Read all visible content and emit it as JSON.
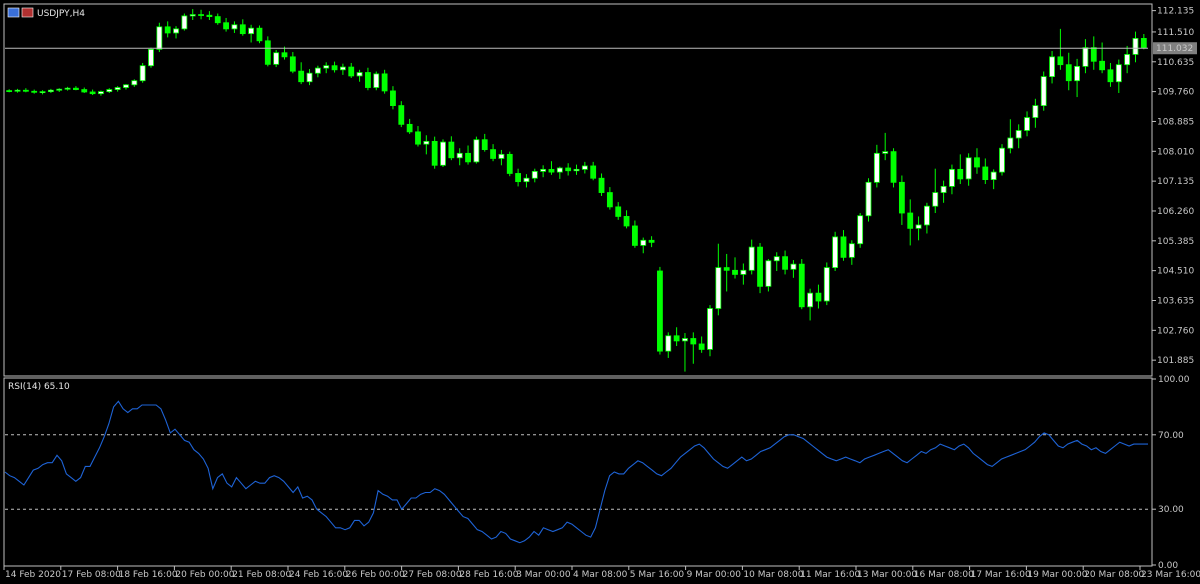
{
  "window": {
    "symbol_title": "USDJPY,H4",
    "indicator_title": "RSI(14) 65.10"
  },
  "colors": {
    "background": "#000000",
    "frame": "#c0c0c0",
    "text": "#c8c8c8",
    "bull": "#00ff00",
    "bull_body": "#ffffff",
    "bear_body": "#00ff00",
    "rsi_line": "#1e63d6",
    "level_line": "#bfbfbf",
    "price_line": "#bcbcbc",
    "current_price_bg": "#808080"
  },
  "chart_data": [
    {
      "type": "candlestick",
      "title": "USDJPY,H4",
      "ylim": [
        101.45,
        112.3
      ],
      "y_ticks": [
        "112.135",
        "111.510",
        "110.635",
        "109.760",
        "108.885",
        "108.010",
        "107.135",
        "106.260",
        "105.385",
        "104.510",
        "103.635",
        "102.760",
        "101.885"
      ],
      "x_ticks": [
        "14 Feb 2020",
        "17 Feb 08:00",
        "18 Feb 16:00",
        "20 Feb 00:00",
        "21 Feb 08:00",
        "24 Feb 16:00",
        "26 Feb 00:00",
        "27 Feb 08:00",
        "28 Feb 16:00",
        "3 Mar 00:00",
        "4 Mar 08:00",
        "5 Mar 16:00",
        "9 Mar 00:00",
        "10 Mar 08:00",
        "11 Mar 16:00",
        "13 Mar 00:00",
        "16 Mar 08:00",
        "17 Mar 16:00",
        "19 Mar 00:00",
        "20 Mar 08:00",
        "23 Mar 16:00"
      ],
      "current_price": "111.032",
      "ohlc": [
        [
          109.79,
          109.83,
          109.74,
          109.78
        ],
        [
          109.78,
          109.84,
          109.73,
          109.8
        ],
        [
          109.8,
          109.86,
          109.74,
          109.77
        ],
        [
          109.77,
          109.82,
          109.7,
          109.74
        ],
        [
          109.74,
          109.8,
          109.68,
          109.76
        ],
        [
          109.76,
          109.84,
          109.72,
          109.8
        ],
        [
          109.8,
          109.86,
          109.75,
          109.83
        ],
        [
          109.83,
          109.9,
          109.79,
          109.86
        ],
        [
          109.86,
          109.92,
          109.8,
          109.82
        ],
        [
          109.82,
          109.88,
          109.72,
          109.75
        ],
        [
          109.75,
          109.82,
          109.66,
          109.7
        ],
        [
          109.7,
          109.79,
          109.64,
          109.76
        ],
        [
          109.76,
          109.86,
          109.72,
          109.82
        ],
        [
          109.82,
          109.92,
          109.76,
          109.88
        ],
        [
          109.88,
          109.98,
          109.82,
          109.96
        ],
        [
          109.96,
          110.12,
          109.9,
          110.08
        ],
        [
          110.08,
          110.6,
          110.02,
          110.52
        ],
        [
          110.52,
          111.05,
          110.46,
          111.0
        ],
        [
          111.0,
          111.78,
          110.92,
          111.66
        ],
        [
          111.66,
          111.82,
          111.35,
          111.48
        ],
        [
          111.48,
          111.68,
          111.32,
          111.6
        ],
        [
          111.6,
          112.05,
          111.55,
          111.98
        ],
        [
          111.98,
          112.18,
          111.86,
          112.02
        ],
        [
          112.02,
          112.16,
          111.88,
          112.0
        ],
        [
          112.0,
          112.12,
          111.86,
          111.96
        ],
        [
          111.96,
          112.05,
          111.72,
          111.78
        ],
        [
          111.78,
          111.92,
          111.52,
          111.6
        ],
        [
          111.6,
          111.82,
          111.48,
          111.72
        ],
        [
          111.72,
          111.88,
          111.4,
          111.46
        ],
        [
          111.46,
          111.72,
          111.2,
          111.62
        ],
        [
          111.62,
          111.7,
          111.18,
          111.25
        ],
        [
          111.25,
          111.38,
          110.5,
          110.56
        ],
        [
          110.56,
          110.98,
          110.48,
          110.9
        ],
        [
          110.9,
          111.08,
          110.7,
          110.78
        ],
        [
          110.78,
          110.92,
          110.3,
          110.36
        ],
        [
          110.36,
          110.62,
          109.98,
          110.05
        ],
        [
          110.05,
          110.42,
          109.95,
          110.3
        ],
        [
          110.3,
          110.52,
          110.18,
          110.45
        ],
        [
          110.45,
          110.62,
          110.3,
          110.52
        ],
        [
          110.52,
          110.64,
          110.32,
          110.4
        ],
        [
          110.4,
          110.58,
          110.25,
          110.48
        ],
        [
          110.48,
          110.6,
          110.16,
          110.22
        ],
        [
          110.22,
          110.4,
          110.05,
          110.32
        ],
        [
          110.32,
          110.46,
          109.8,
          109.88
        ],
        [
          109.88,
          110.35,
          109.8,
          110.28
        ],
        [
          110.28,
          110.4,
          109.7,
          109.78
        ],
        [
          109.78,
          109.92,
          109.24,
          109.35
        ],
        [
          109.35,
          109.48,
          108.72,
          108.8
        ],
        [
          108.8,
          108.96,
          108.52,
          108.58
        ],
        [
          108.58,
          108.75,
          108.15,
          108.22
        ],
        [
          108.22,
          108.48,
          107.92,
          108.3
        ],
        [
          108.3,
          108.44,
          107.5,
          107.6
        ],
        [
          107.6,
          108.36,
          107.55,
          108.28
        ],
        [
          108.28,
          108.45,
          107.75,
          107.82
        ],
        [
          107.82,
          108.1,
          107.6,
          107.95
        ],
        [
          107.95,
          108.18,
          107.62,
          107.7
        ],
        [
          107.7,
          108.44,
          107.65,
          108.35
        ],
        [
          108.35,
          108.52,
          108.0,
          108.06
        ],
        [
          108.06,
          108.22,
          107.72,
          107.8
        ],
        [
          107.8,
          108.05,
          107.6,
          107.92
        ],
        [
          107.92,
          108.0,
          107.28,
          107.36
        ],
        [
          107.36,
          107.5,
          106.98,
          107.12
        ],
        [
          107.12,
          107.34,
          106.95,
          107.22
        ],
        [
          107.22,
          107.5,
          107.1,
          107.42
        ],
        [
          107.42,
          107.6,
          107.25,
          107.48
        ],
        [
          107.48,
          107.72,
          107.32,
          107.4
        ],
        [
          107.4,
          107.56,
          107.2,
          107.52
        ],
        [
          107.52,
          107.66,
          107.3,
          107.44
        ],
        [
          107.44,
          107.62,
          107.32,
          107.48
        ],
        [
          107.48,
          107.7,
          107.36,
          107.58
        ],
        [
          107.58,
          107.7,
          107.16,
          107.22
        ],
        [
          107.22,
          107.36,
          106.7,
          106.8
        ],
        [
          106.8,
          106.96,
          106.3,
          106.38
        ],
        [
          106.38,
          106.52,
          106.0,
          106.1
        ],
        [
          106.1,
          106.28,
          105.75,
          105.82
        ],
        [
          105.82,
          105.98,
          105.18,
          105.25
        ],
        [
          105.25,
          105.48,
          105.02,
          105.4
        ],
        [
          105.4,
          105.52,
          105.2,
          105.34
        ],
        [
          104.5,
          104.62,
          102.05,
          102.15
        ],
        [
          102.15,
          102.7,
          101.95,
          102.6
        ],
        [
          102.6,
          102.85,
          102.3,
          102.45
        ],
        [
          102.45,
          102.68,
          101.55,
          102.52
        ],
        [
          102.52,
          102.7,
          101.78,
          102.36
        ],
        [
          102.36,
          102.58,
          102.1,
          102.2
        ],
        [
          102.2,
          103.5,
          102.0,
          103.4
        ],
        [
          103.4,
          105.3,
          103.2,
          104.6
        ],
        [
          104.6,
          105.0,
          103.9,
          104.52
        ],
        [
          104.52,
          104.9,
          104.28,
          104.4
        ],
        [
          104.4,
          104.72,
          104.1,
          104.52
        ],
        [
          104.52,
          105.42,
          104.4,
          105.2
        ],
        [
          105.2,
          105.32,
          103.85,
          104.05
        ],
        [
          104.05,
          104.85,
          103.9,
          104.8
        ],
        [
          104.8,
          105.05,
          104.5,
          104.92
        ],
        [
          104.92,
          105.1,
          104.4,
          104.55
        ],
        [
          104.55,
          104.82,
          104.3,
          104.7
        ],
        [
          104.7,
          104.85,
          103.38,
          103.45
        ],
        [
          103.45,
          103.98,
          103.05,
          103.85
        ],
        [
          103.85,
          104.1,
          103.4,
          103.62
        ],
        [
          103.62,
          104.75,
          103.5,
          104.6
        ],
        [
          104.6,
          105.65,
          104.5,
          105.5
        ],
        [
          105.5,
          105.7,
          104.8,
          104.9
        ],
        [
          104.9,
          105.4,
          104.68,
          105.3
        ],
        [
          105.3,
          106.2,
          105.18,
          106.12
        ],
        [
          106.12,
          107.22,
          105.95,
          107.1
        ],
        [
          107.1,
          108.2,
          106.95,
          107.95
        ],
        [
          107.95,
          108.55,
          107.75,
          108.0
        ],
        [
          108.0,
          108.1,
          106.95,
          107.1
        ],
        [
          107.1,
          107.3,
          105.85,
          106.2
        ],
        [
          106.2,
          106.6,
          105.25,
          105.75
        ],
        [
          105.75,
          106.1,
          105.4,
          105.85
        ],
        [
          105.85,
          106.5,
          105.6,
          106.4
        ],
        [
          106.4,
          107.5,
          106.2,
          106.8
        ],
        [
          106.8,
          107.15,
          106.5,
          106.98
        ],
        [
          106.98,
          107.62,
          106.75,
          107.48
        ],
        [
          107.48,
          107.92,
          107.05,
          107.2
        ],
        [
          107.2,
          107.95,
          107.0,
          107.82
        ],
        [
          107.82,
          108.1,
          107.35,
          107.55
        ],
        [
          107.55,
          107.8,
          107.05,
          107.18
        ],
        [
          107.18,
          107.48,
          106.9,
          107.4
        ],
        [
          107.4,
          108.22,
          107.3,
          108.1
        ],
        [
          108.1,
          108.95,
          107.95,
          108.4
        ],
        [
          108.4,
          108.8,
          108.1,
          108.62
        ],
        [
          108.62,
          109.18,
          108.45,
          109.0
        ],
        [
          109.0,
          109.55,
          108.7,
          109.35
        ],
        [
          109.35,
          110.35,
          109.2,
          110.2
        ],
        [
          110.2,
          110.95,
          110.0,
          110.78
        ],
        [
          110.78,
          111.6,
          110.4,
          110.55
        ],
        [
          110.55,
          110.9,
          109.8,
          110.08
        ],
        [
          110.08,
          110.72,
          109.6,
          110.5
        ],
        [
          110.5,
          111.3,
          110.3,
          111.05
        ],
        [
          111.05,
          111.38,
          110.4,
          110.65
        ],
        [
          110.65,
          111.2,
          110.3,
          110.4
        ],
        [
          110.4,
          110.6,
          109.9,
          110.05
        ],
        [
          110.05,
          110.7,
          109.72,
          110.55
        ],
        [
          110.55,
          111.1,
          110.3,
          110.85
        ],
        [
          110.85,
          111.52,
          110.62,
          111.32
        ],
        [
          111.32,
          111.45,
          111.0,
          111.05
        ]
      ]
    },
    {
      "type": "line",
      "title": "RSI(14) 65.10",
      "ylim": [
        0,
        100
      ],
      "y_ticks": [
        "100.00",
        "70.00",
        "30.00",
        "0.00"
      ],
      "levels": [
        70,
        30
      ],
      "values": [
        50,
        48,
        47,
        45,
        43,
        47,
        51,
        52,
        54,
        55,
        55,
        59,
        56,
        49,
        47,
        45,
        47,
        53,
        53,
        58,
        63,
        69,
        76,
        85,
        88,
        84,
        82,
        84,
        84,
        86,
        86,
        86,
        86,
        84,
        78,
        71,
        73,
        70,
        67,
        66,
        62,
        60,
        57,
        52,
        41,
        47,
        49,
        44,
        42,
        47,
        44,
        41,
        43,
        45,
        44,
        44,
        47,
        48,
        47,
        45,
        42,
        39,
        42,
        36,
        37,
        35,
        30,
        28,
        26,
        23,
        20,
        20,
        19,
        20,
        24,
        24,
        21,
        23,
        28,
        40,
        38,
        37,
        35,
        35,
        30,
        33,
        36,
        36,
        38,
        39,
        39,
        41,
        40,
        38,
        35,
        32,
        29,
        26,
        25,
        22,
        19,
        18,
        16,
        14,
        15,
        18,
        17,
        14,
        13,
        12,
        13,
        15,
        18,
        16,
        20,
        19,
        18,
        19,
        20,
        23,
        22,
        20,
        18,
        16,
        15,
        20,
        30,
        40,
        48,
        50,
        49,
        49,
        52,
        54,
        56,
        55,
        53,
        51,
        49,
        48,
        50,
        52,
        55,
        58,
        60,
        62,
        64,
        65,
        63,
        60,
        57,
        55,
        53,
        52,
        54,
        56,
        58,
        56,
        57,
        59,
        61,
        62,
        63,
        65,
        67,
        69,
        70,
        70,
        69,
        68,
        66,
        64,
        62,
        60,
        58,
        57,
        56,
        57,
        58,
        57,
        56,
        55,
        57,
        58,
        59,
        60,
        61,
        62,
        60,
        58,
        56,
        55,
        57,
        59,
        61,
        60,
        62,
        63,
        65,
        64,
        63,
        62,
        64,
        65,
        63,
        60,
        58,
        56,
        54,
        53,
        55,
        57,
        58,
        59,
        60,
        61,
        62,
        64,
        66,
        69,
        71,
        70,
        67,
        64,
        63,
        65,
        66,
        67,
        65,
        64,
        62,
        63,
        61,
        60,
        62,
        64,
        66,
        65,
        64,
        65,
        65,
        65,
        65
      ]
    }
  ]
}
